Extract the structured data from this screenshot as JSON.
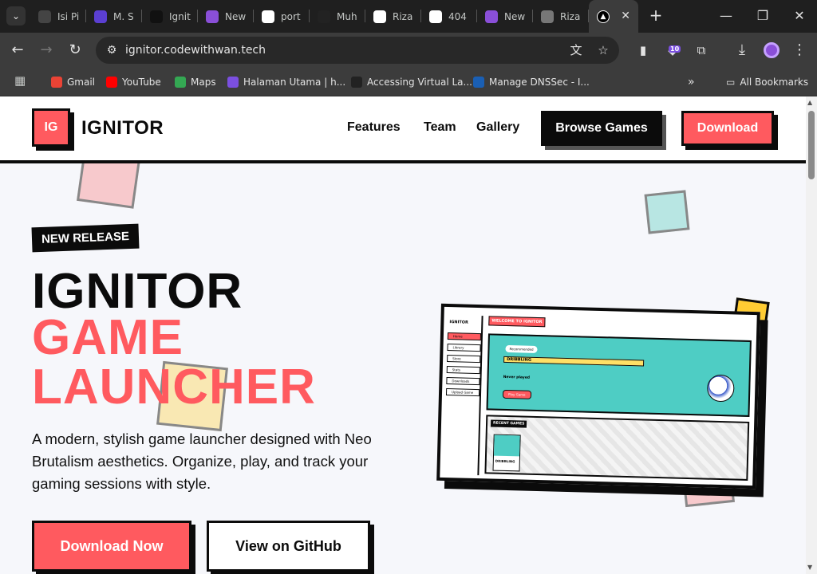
{
  "browser": {
    "tabs": [
      {
        "label": "Isi Pi",
        "favicon": "openai-icon",
        "color": "#444444"
      },
      {
        "label": "M. S",
        "favicon": "purple-square-icon",
        "color": "#5b3fd1"
      },
      {
        "label": "Ignit",
        "favicon": "vercel-icon",
        "color": "#111111"
      },
      {
        "label": "New",
        "favicon": "heart-purple-icon",
        "color": "#8a4fd8"
      },
      {
        "label": "port",
        "favicon": "google-icon",
        "color": "#ffffff"
      },
      {
        "label": "Muh",
        "favicon": "star-icon",
        "color": "#222222"
      },
      {
        "label": "Riza",
        "favicon": "v0-icon",
        "color": "#ffffff"
      },
      {
        "label": "404",
        "favicon": "heart-icon",
        "color": "#ffffff"
      },
      {
        "label": "New",
        "favicon": "heart-purple-icon",
        "color": "#8a4fd8"
      },
      {
        "label": "Riza",
        "favicon": "globe-icon",
        "color": "#777777"
      }
    ],
    "active_tab_favicon": "vercel-icon",
    "url": "ignitor.codewithwan.tech",
    "extension_badge": "10",
    "bookmarks": [
      {
        "label": "Gmail",
        "favicon": "gmail-icon",
        "color": "#ea4335"
      },
      {
        "label": "YouTube",
        "favicon": "youtube-icon",
        "color": "#ff0000"
      },
      {
        "label": "Maps",
        "favicon": "maps-icon",
        "color": "#34a853"
      },
      {
        "label": "Halaman Utama | h...",
        "favicon": "h-icon",
        "color": "#7b4fe0"
      },
      {
        "label": "Accessing Virtual La...",
        "favicon": "eight-icon",
        "color": "#222222"
      },
      {
        "label": "Manage DNSSec - I...",
        "favicon": "cloud-icon",
        "color": "#1a5fb4"
      }
    ],
    "all_bookmarks": "All Bookmarks"
  },
  "site": {
    "logo_mark": "IG",
    "logo_text": "IGNITOR",
    "nav": [
      "Features",
      "Team",
      "Gallery"
    ],
    "browse_button": "Browse Games",
    "download_button": "Download",
    "badge": "NEW RELEASE",
    "headline": [
      "IGNITOR",
      "GAME",
      "LAUNCHER"
    ],
    "description": "A modern, stylish game launcher designed with Neo Brutalism aesthetics. Organize, play, and track your gaming sessions with style.",
    "cta_primary": "Download Now",
    "cta_secondary": "View on GitHub",
    "colors": {
      "accent": "#ff5a5f",
      "dark": "#0b0b0b",
      "teal": "#4ecdc4",
      "yellow": "#ffcc33"
    }
  },
  "mockup": {
    "logo": "IGNITOR",
    "welcome": "WELCOME TO IGNITOR",
    "sidebar": [
      "Home",
      "Library",
      "Store",
      "Stats",
      "Downloads",
      "Upload Game"
    ],
    "hero_chip": "Recommended",
    "game_title": "DRIBBLING",
    "game_meta": "Never played",
    "play": "Play Game",
    "recent_label": "RECENT GAMES",
    "recent_game": "DRIBBLING"
  }
}
